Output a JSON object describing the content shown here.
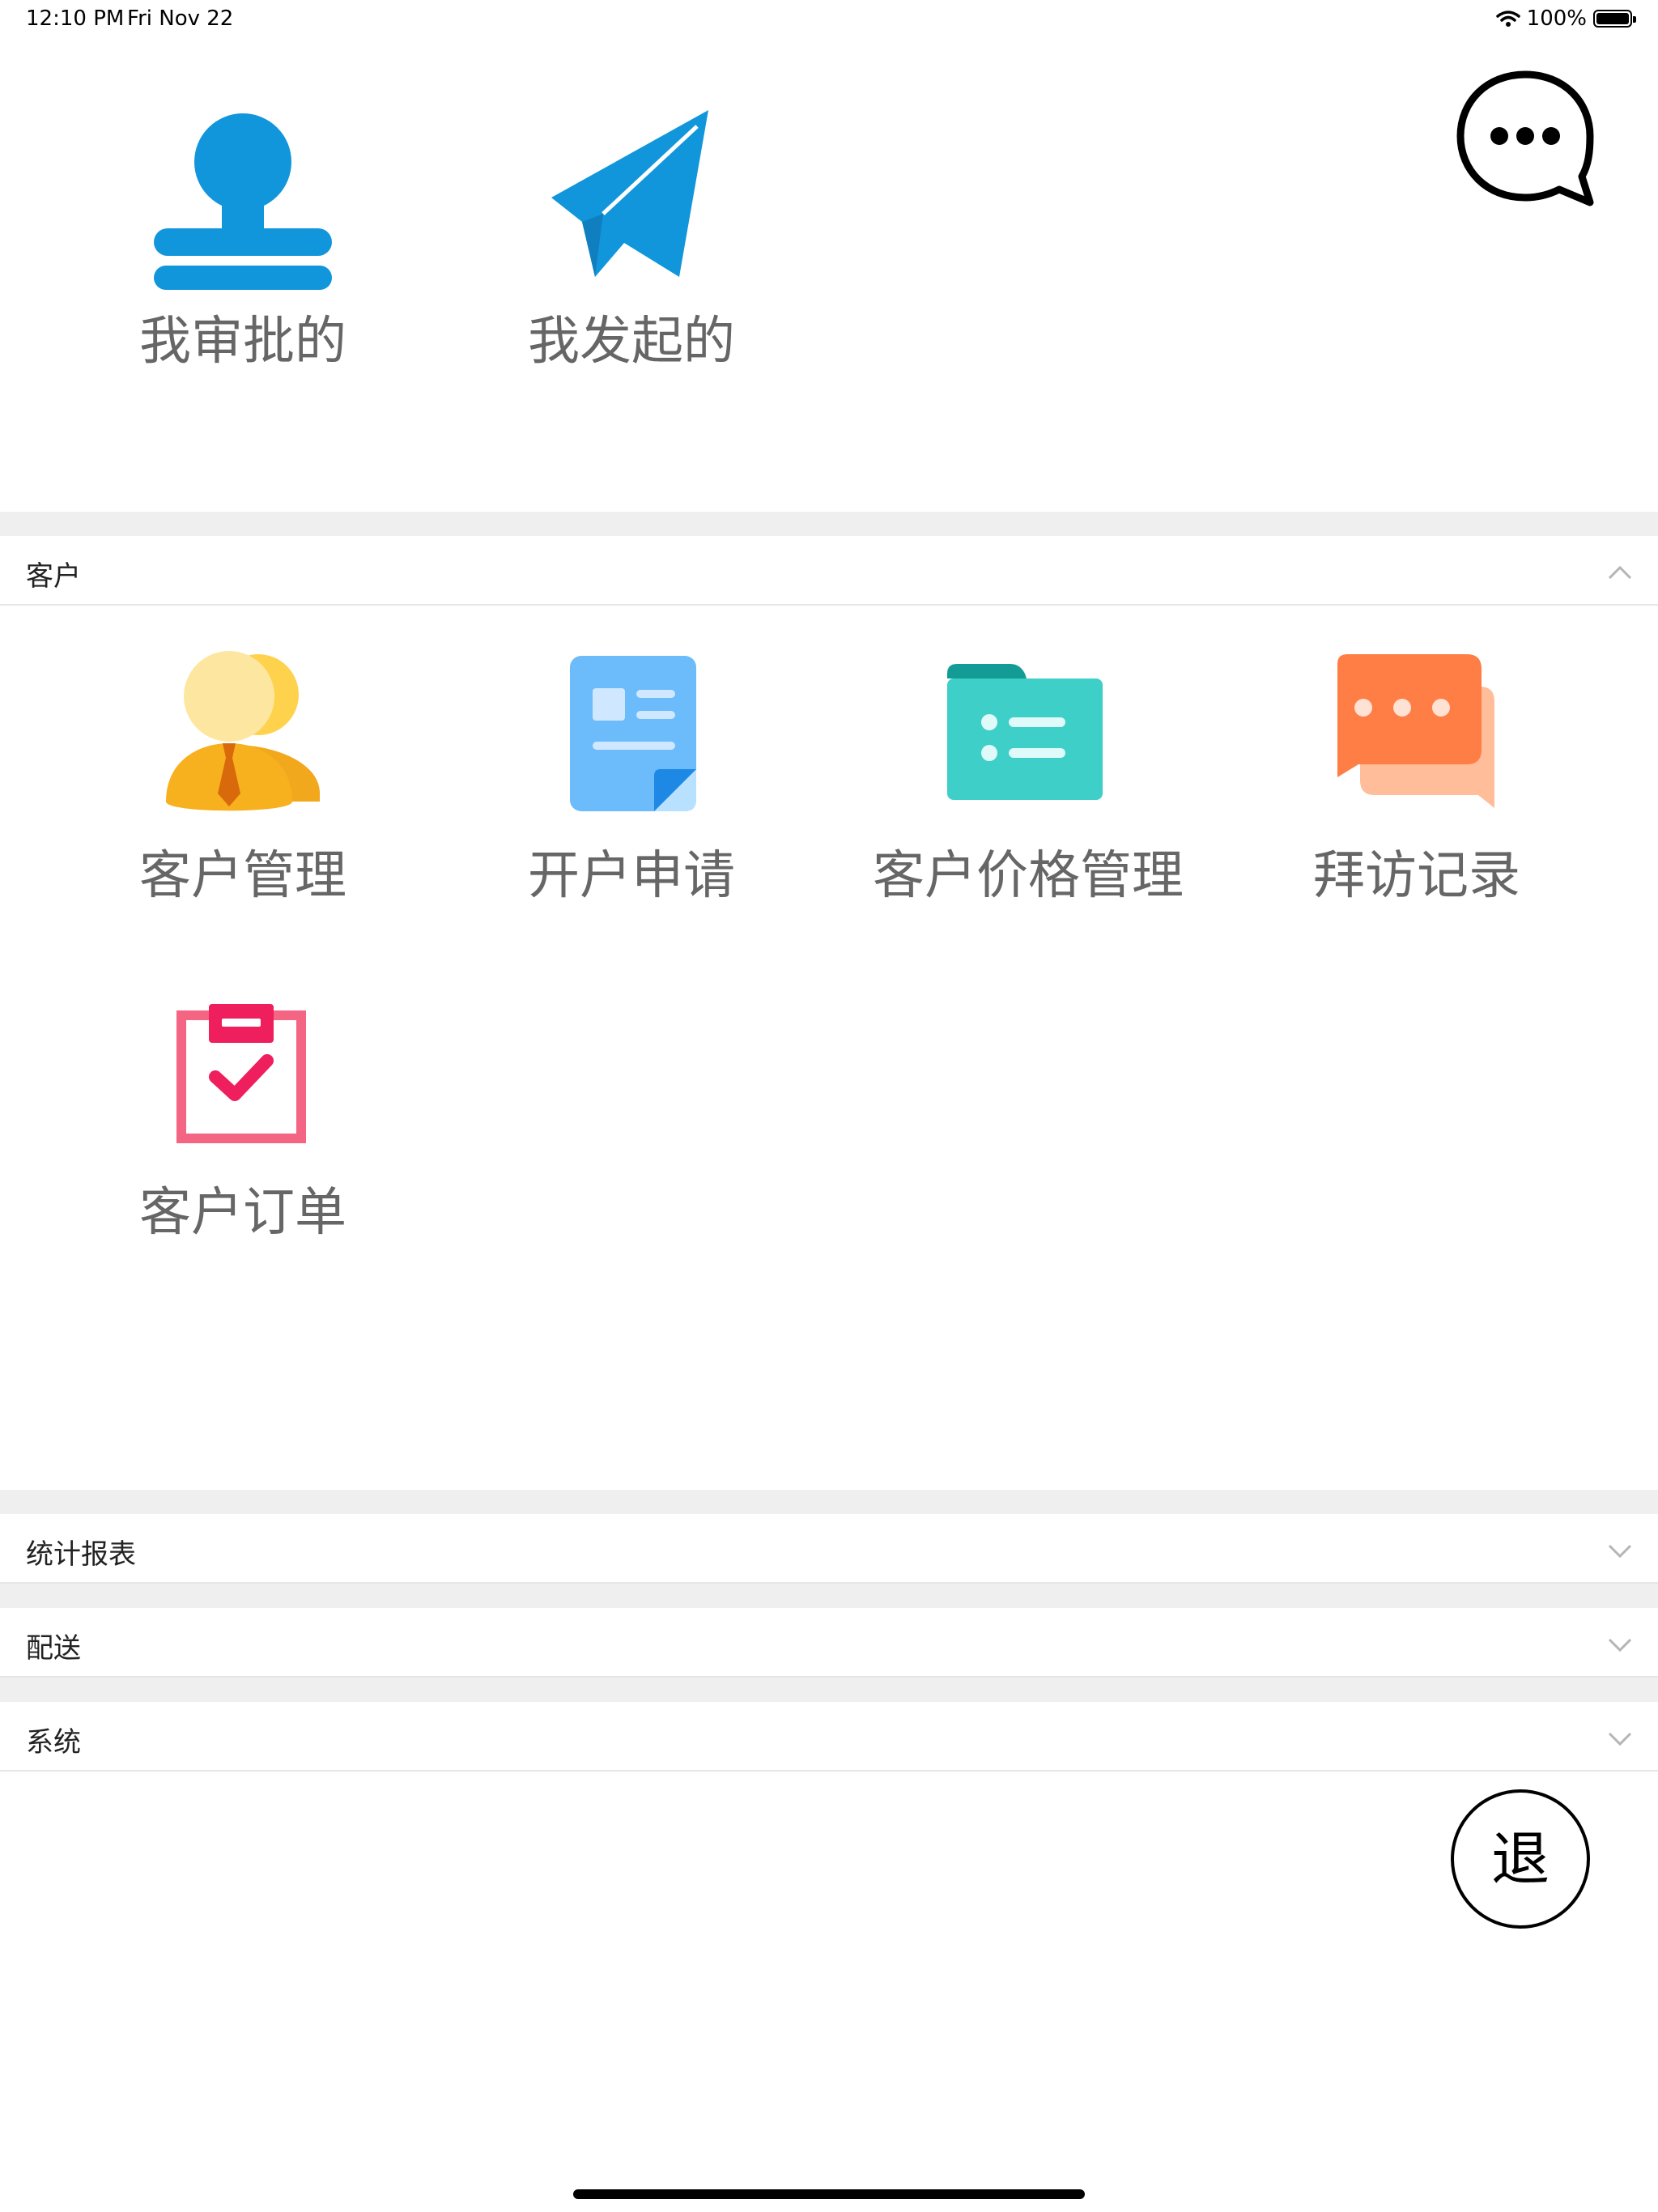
{
  "status_bar": {
    "time": "12:10 PM",
    "date": "Fri Nov 22",
    "battery": "100%"
  },
  "top_actions": [
    {
      "label": "我审批的",
      "icon": "stamp-icon"
    },
    {
      "label": "我发起的",
      "icon": "paper-plane-icon"
    }
  ],
  "chat_button": {
    "icon": "chat-bubble-icon"
  },
  "sections": [
    {
      "title": "客户",
      "expanded": true,
      "items": [
        {
          "label": "客户管理",
          "icon": "customers-icon"
        },
        {
          "label": "开户申请",
          "icon": "document-icon"
        },
        {
          "label": "客户价格管理",
          "icon": "folder-list-icon"
        },
        {
          "label": "拜访记录",
          "icon": "chat-record-icon"
        },
        {
          "label": "客户订单",
          "icon": "clipboard-check-icon"
        }
      ]
    },
    {
      "title": "统计报表",
      "expanded": false
    },
    {
      "title": "配送",
      "expanded": false
    },
    {
      "title": "系统",
      "expanded": false
    }
  ],
  "logout_button": {
    "label": "退"
  },
  "colors": {
    "blue": "#1296db",
    "gray_gap": "#efefef",
    "label_gray": "#666666"
  }
}
